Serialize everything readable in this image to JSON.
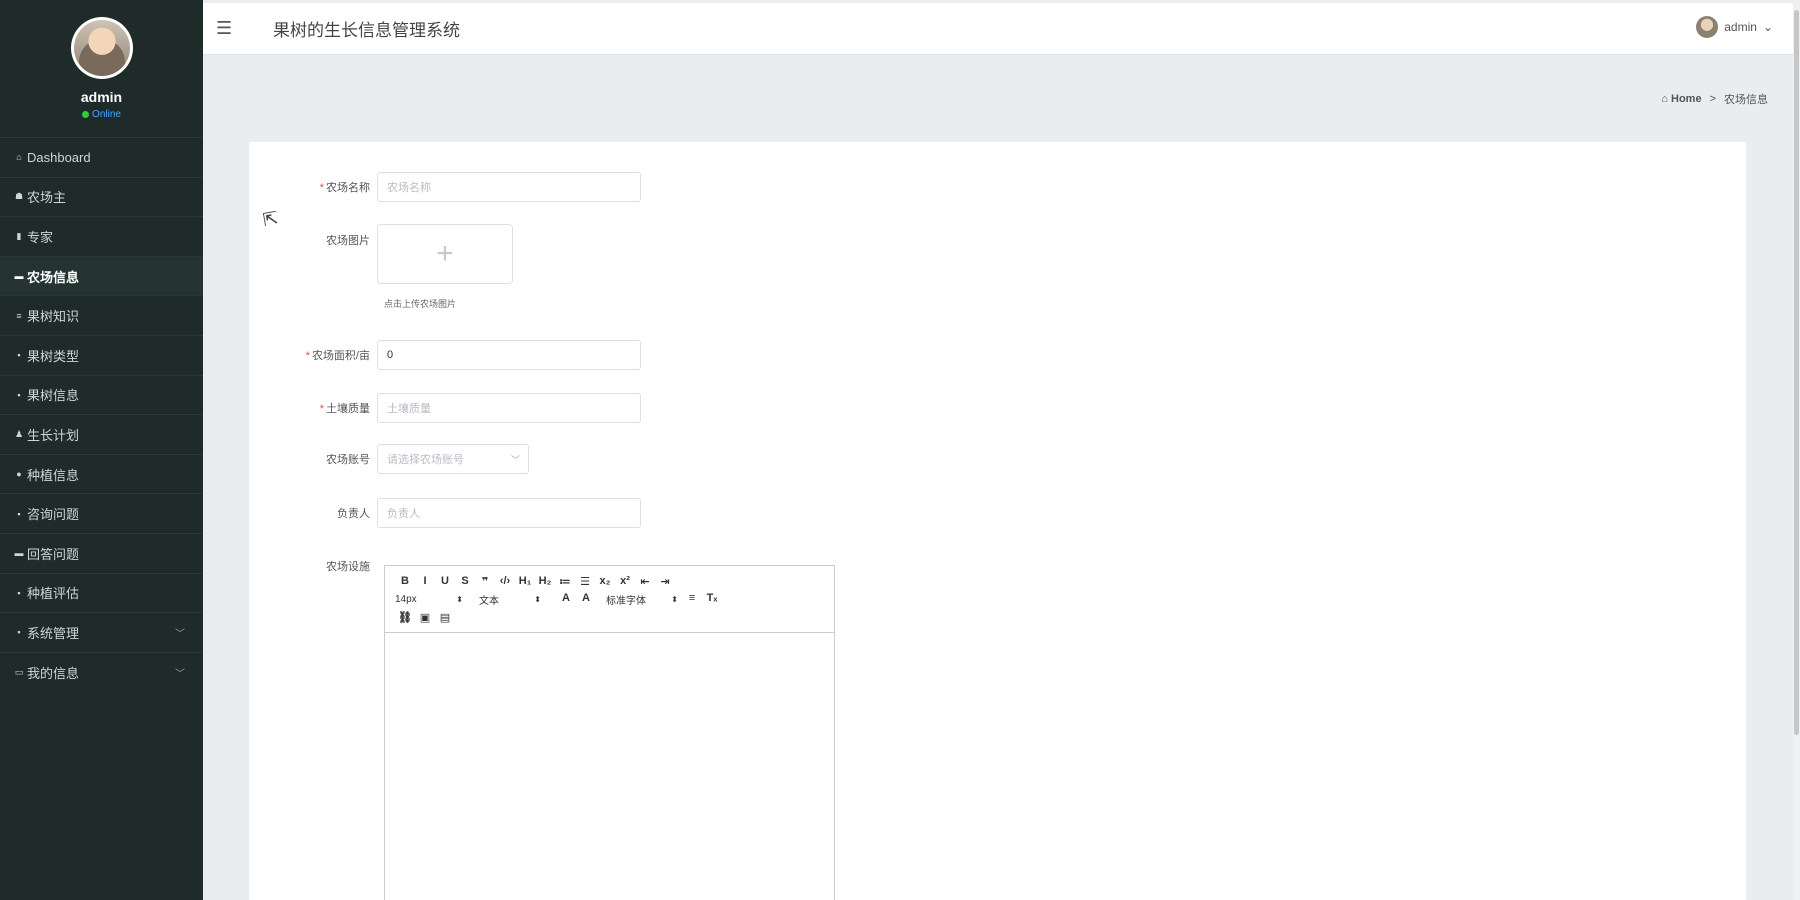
{
  "app": {
    "title": "果树的生长信息管理系统"
  },
  "profile": {
    "name": "admin",
    "status": "Online"
  },
  "sidebar": {
    "items": [
      {
        "label": "Dashboard",
        "icon": "⌂"
      },
      {
        "label": "农场主",
        "icon": "☗"
      },
      {
        "label": "专家",
        "icon": "▮"
      },
      {
        "label": "农场信息",
        "icon": "▬"
      },
      {
        "label": "果树知识",
        "icon": "≡"
      },
      {
        "label": "果树类型",
        "icon": "▪"
      },
      {
        "label": "果树信息",
        "icon": "▪"
      },
      {
        "label": "生长计划",
        "icon": "♟"
      },
      {
        "label": "种植信息",
        "icon": "●"
      },
      {
        "label": "咨询问题",
        "icon": "▪"
      },
      {
        "label": "回答问题",
        "icon": "▬"
      },
      {
        "label": "种植评估",
        "icon": "▪"
      },
      {
        "label": "系统管理",
        "icon": "▪",
        "chevron": "﹀"
      },
      {
        "label": "我的信息",
        "icon": "▭",
        "chevron": "﹀"
      }
    ]
  },
  "topbar": {
    "user": "admin",
    "menu_icon": "☰",
    "user_chevron": "⌄"
  },
  "breadcrumb": {
    "home": "Home",
    "separator": ">",
    "current": "农场信息"
  },
  "form": {
    "farm_name": {
      "label": "农场名称",
      "placeholder": "农场名称"
    },
    "farm_image": {
      "label": "农场图片",
      "hint": "点击上传农场图片"
    },
    "farm_area": {
      "label": "农场面积/亩",
      "value": "0"
    },
    "soil_quality": {
      "label": "土壤质量",
      "placeholder": "土壤质量"
    },
    "farm_account": {
      "label": "农场账号",
      "placeholder": "请选择农场账号"
    },
    "manager": {
      "label": "负责人",
      "placeholder": "负责人"
    },
    "facilities": {
      "label": "农场设施"
    }
  },
  "editor": {
    "font_size": "14px",
    "format": "文本",
    "font_family": "标准字体",
    "buttons_row1": [
      "B",
      "I",
      "U",
      "S",
      "❞",
      "‹/›",
      "H₁",
      "H₂",
      "≔",
      "☰",
      "x₂",
      "x²",
      "⇤",
      "⇥"
    ],
    "buttons_row2_extra": [
      "A",
      "A",
      "≡",
      "Tₓ"
    ],
    "buttons_row3": [
      "⛓",
      "▣",
      "▤"
    ]
  }
}
